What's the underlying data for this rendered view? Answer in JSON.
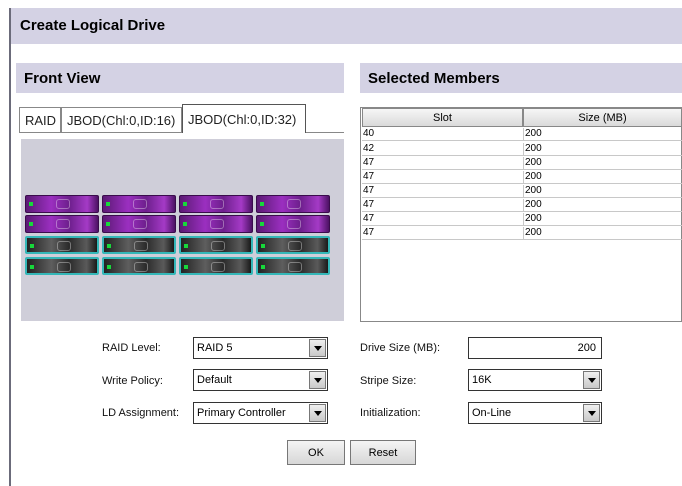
{
  "page": {
    "title": "Create Logical Drive"
  },
  "front_view": {
    "heading": "Front View",
    "tabs": [
      "RAID",
      "JBOD(Chl:0,ID:16)",
      "JBOD(Chl:0,ID:32)"
    ],
    "active_tab": 2,
    "drive_rows": [
      "purple",
      "purple",
      "black",
      "black"
    ],
    "drives_per_row": 4,
    "colors": {
      "unselected_drive": "#9b2fc0",
      "selected_drive": "#3a3a3a",
      "selection_outline": "#34b7b8",
      "led": "#17d83a",
      "panel": "#cfced9",
      "header": "#d4d2e4"
    }
  },
  "members": {
    "heading": "Selected Members",
    "columns": [
      "Slot",
      "Size (MB)"
    ],
    "rows": [
      {
        "slot": "40",
        "size": "200"
      },
      {
        "slot": "42",
        "size": "200"
      },
      {
        "slot": "47",
        "size": "200"
      },
      {
        "slot": "47",
        "size": "200"
      },
      {
        "slot": "47",
        "size": "200"
      },
      {
        "slot": "47",
        "size": "200"
      },
      {
        "slot": "47",
        "size": "200"
      },
      {
        "slot": "47",
        "size": "200"
      }
    ]
  },
  "form": {
    "raid_level": {
      "label": "RAID Level:",
      "value": "RAID 5"
    },
    "write_policy": {
      "label": "Write Policy:",
      "value": "Default"
    },
    "ld_assignment": {
      "label": "LD Assignment:",
      "value": "Primary Controller"
    },
    "drive_size": {
      "label": "Drive Size (MB):",
      "value": "200"
    },
    "stripe_size": {
      "label": "Stripe Size:",
      "value": "16K"
    },
    "initialization": {
      "label": "Initialization:",
      "value": "On-Line"
    }
  },
  "buttons": {
    "ok": "OK",
    "reset": "Reset"
  }
}
